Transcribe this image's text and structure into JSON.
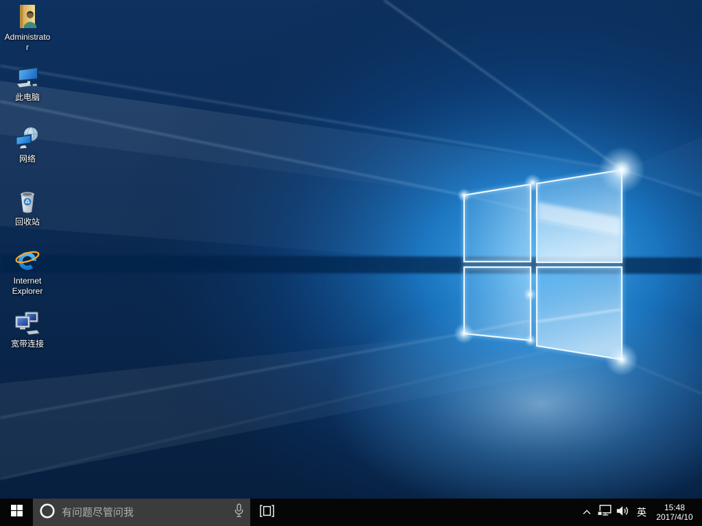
{
  "desktop": {
    "wallpaper_name": "windows-10-hero",
    "icons": [
      {
        "label": "Administrator",
        "icon": "user-folder-icon"
      },
      {
        "label": "此电脑",
        "icon": "this-pc-icon"
      },
      {
        "label": "网络",
        "icon": "network-globe-icon"
      },
      {
        "label": "回收站",
        "icon": "recycle-bin-icon"
      },
      {
        "label": "Internet Explorer",
        "icon": "internet-explorer-icon"
      },
      {
        "label": "宽带连接",
        "icon": "broadband-connection-icon"
      }
    ]
  },
  "taskbar": {
    "start": {
      "icon": "windows-start-icon"
    },
    "search": {
      "placeholder": "有问题尽管问我",
      "left_icon": "cortana-circle-icon",
      "right_icon": "microphone-icon"
    },
    "task_view": {
      "icon": "task-view-icon"
    },
    "tray": {
      "hidden_icons_icon": "chevron-up-icon",
      "network_icon": "network-ethernet-icon",
      "volume_icon": "speaker-icon",
      "language": "英",
      "clock": {
        "time": "15:48",
        "date": "2017/4/10"
      }
    }
  },
  "colors": {
    "taskbar_bg": "#060606",
    "search_box_bg": "#3c3c3c",
    "wallpaper_accent": "#1e86dc",
    "icon_text": "#ffffff"
  }
}
